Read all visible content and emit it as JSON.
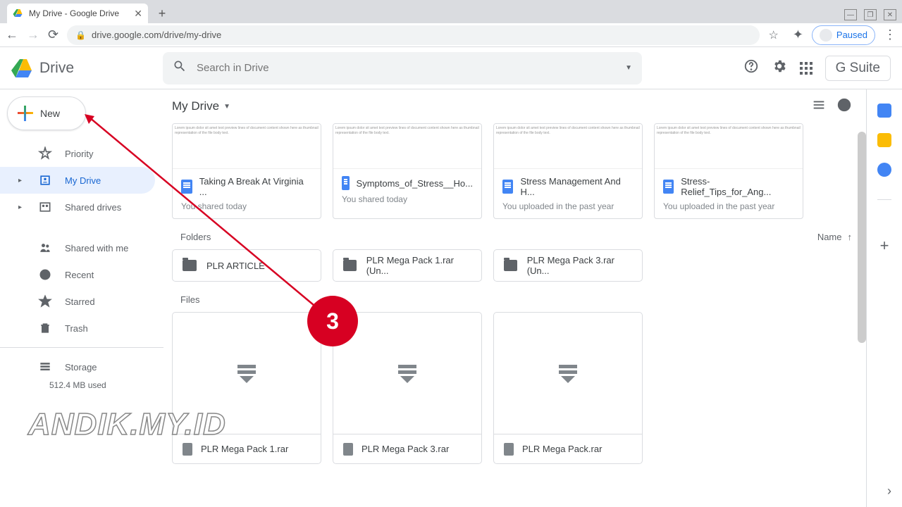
{
  "browser": {
    "tab_title": "My Drive - Google Drive",
    "url": "drive.google.com/drive/my-drive",
    "paused": "Paused"
  },
  "header": {
    "product": "Drive",
    "search_placeholder": "Search in Drive",
    "gsuite": "G Suite"
  },
  "sidebar": {
    "new": "New",
    "priority": "Priority",
    "my_drive": "My Drive",
    "shared_drives": "Shared drives",
    "shared_with_me": "Shared with me",
    "recent": "Recent",
    "starred": "Starred",
    "trash": "Trash",
    "storage": "Storage",
    "storage_used": "512.4 MB used"
  },
  "crumb": {
    "label": "My Drive"
  },
  "suggestions": [
    {
      "title": "Taking A Break At Virginia ...",
      "sub": "You shared today"
    },
    {
      "title": "Symptoms_of_Stress__Ho...",
      "sub": "You shared today"
    },
    {
      "title": "Stress Management And H...",
      "sub": "You uploaded in the past year"
    },
    {
      "title": "Stress-Relief_Tips_for_Ang...",
      "sub": "You uploaded in the past year"
    }
  ],
  "sections": {
    "folders": "Folders",
    "files": "Files",
    "sort_label": "Name"
  },
  "folders": [
    {
      "name": "PLR ARTICLE"
    },
    {
      "name": "PLR Mega Pack 1.rar (Un..."
    },
    {
      "name": "PLR Mega Pack 3.rar (Un..."
    }
  ],
  "files": [
    {
      "name": "PLR Mega Pack 1.rar"
    },
    {
      "name": "PLR Mega Pack 3.rar"
    },
    {
      "name": "PLR Mega Pack.rar"
    }
  ],
  "annotation": {
    "number": "3",
    "watermark": "ANDIK.MY.ID"
  }
}
